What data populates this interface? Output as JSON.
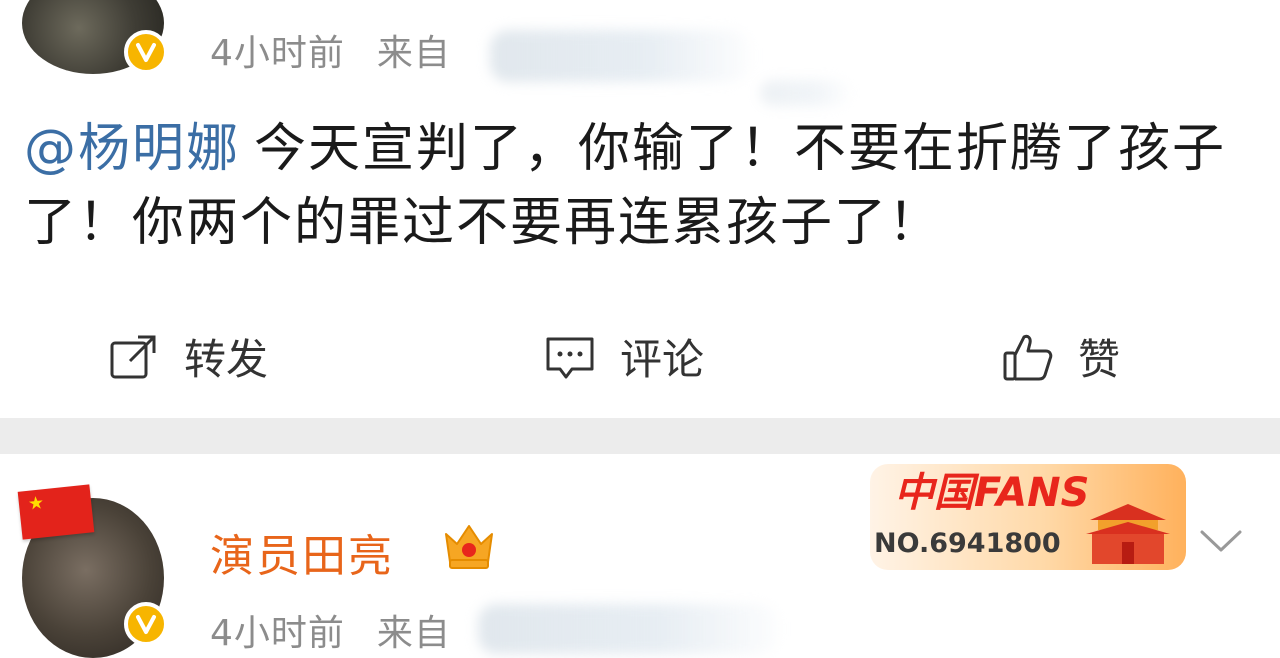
{
  "post1": {
    "time": "4小时前",
    "source_label": "来自",
    "mention": "@杨明娜",
    "text": "今天宣判了，你输了！不要在折腾了孩子了！你两个的罪过不要再连累孩子了！",
    "actions": {
      "repost_label": "转发",
      "comment_label": "评论",
      "like_label": "赞"
    }
  },
  "post2": {
    "username": "演员田亮",
    "time": "4小时前",
    "source_label": "来自",
    "fans_badge": {
      "title": "中国FANS",
      "number": "NO.6941800"
    }
  },
  "colors": {
    "accent_link": "#3b6ea5",
    "username": "#e8651a",
    "verified": "#f7b500",
    "meta_text": "#8c8c8c"
  },
  "icons": [
    "verified-v-icon",
    "repost-icon",
    "comment-icon",
    "like-icon",
    "crown-icon",
    "flag-icon",
    "chevron-down-icon"
  ]
}
